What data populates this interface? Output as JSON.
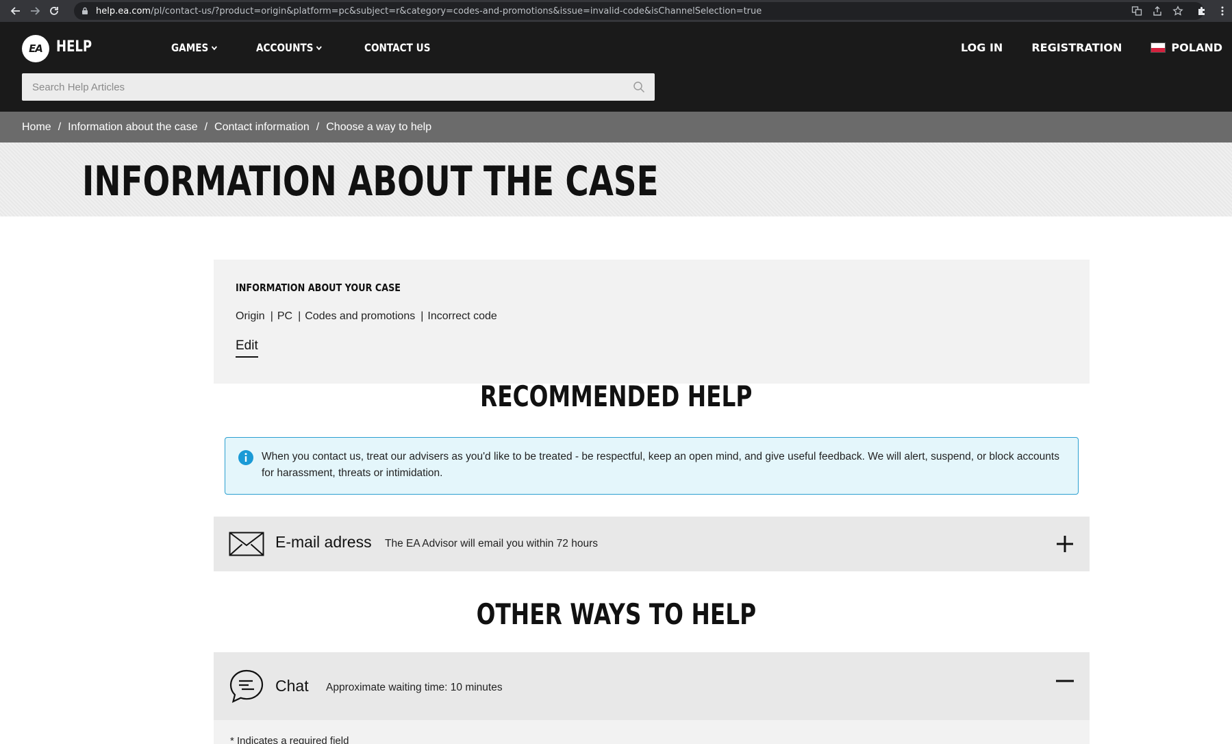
{
  "browser": {
    "url_domain": "help.ea.com",
    "url_path": "/pl/contact-us/?product=origin&platform=pc&subject=r&category=codes-and-promotions&issue=invalid-code&isChannelSelection=true"
  },
  "header": {
    "logo_text": "EA",
    "brand": "HELP",
    "nav": {
      "games": "GAMES",
      "accounts": "ACCOUNTS",
      "contact": "CONTACT US"
    },
    "right_nav": {
      "login": "LOG IN",
      "registration": "REGISTRATION",
      "region": "POLAND"
    },
    "search": {
      "placeholder": "Search Help Articles"
    }
  },
  "breadcrumb": {
    "items": [
      "Home",
      "Information about the case",
      "Contact information",
      "Choose a way to help"
    ],
    "separator": "/"
  },
  "page": {
    "title": "INFORMATION ABOUT THE CASE"
  },
  "case_info": {
    "heading": "INFORMATION ABOUT YOUR CASE",
    "tags": [
      "Origin",
      "PC",
      "Codes and promotions",
      "Incorrect code"
    ],
    "tag_separator": "|",
    "edit_label": "Edit"
  },
  "recommended": {
    "heading": "RECOMMENDED HELP",
    "notice": "When you contact us, treat our advisers as you'd like to be treated - be respectful, keep an open mind, and give useful feedback. We will alert, suspend, or block accounts for harassment, threats or intimidation.",
    "email_option": {
      "title": "E-mail adress",
      "description": "The EA Advisor will email you within 72 hours",
      "icon": "envelope-icon",
      "state": "collapsed"
    }
  },
  "other": {
    "heading": "OTHER WAYS TO HELP",
    "chat_option": {
      "title": "Chat",
      "description": "Approximate waiting time: 10 minutes",
      "icon": "chat-bubble-icon",
      "state": "expanded"
    },
    "required_note": "* Indicates a required field"
  },
  "colors": {
    "header_bg": "#1a1a1a",
    "breadcrumb_bg": "#6b6b6b",
    "notice_bg": "#e4f6fb",
    "notice_border": "#2a9fd0",
    "info_icon": "#1a9ad6",
    "flag_white": "#ffffff",
    "flag_red": "#d4213d"
  }
}
